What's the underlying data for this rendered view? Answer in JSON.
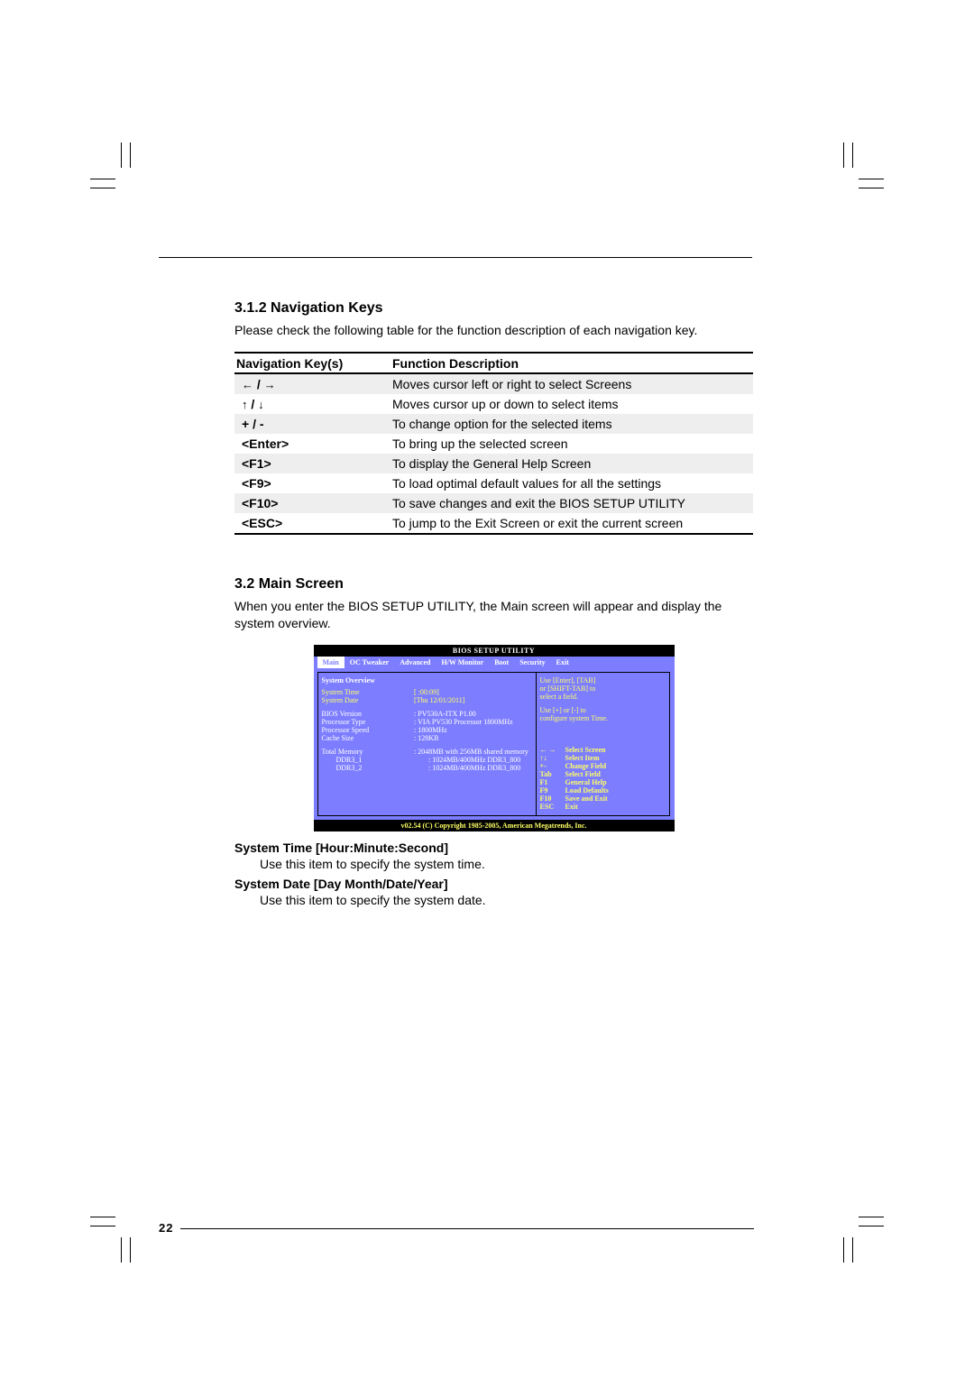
{
  "section1": {
    "title": "3.1.2 Navigation Keys",
    "intro": "Please check the following table for the function description of each navigation key."
  },
  "table": {
    "head_key": "Navigation Key(s)",
    "head_desc": "Function Description",
    "rows": [
      {
        "key": "← / →",
        "desc": "Moves cursor left or right to select Screens",
        "shaded": true,
        "arrows": "lr"
      },
      {
        "key": "↑ / ↓",
        "desc": "Moves cursor up or down to select items",
        "arrows": "ud"
      },
      {
        "key": "+  /  -",
        "desc": "To change option for the selected items",
        "shaded": true
      },
      {
        "key": "<Enter>",
        "desc": "To bring up the selected screen"
      },
      {
        "key": "<F1>",
        "desc": "To display the General Help Screen",
        "shaded": true
      },
      {
        "key": "<F9>",
        "desc": "To load optimal default values for all the settings"
      },
      {
        "key": "<F10>",
        "desc": "To save changes and exit the BIOS SETUP UTILITY",
        "shaded": true
      },
      {
        "key": "<ESC>",
        "desc": "To jump to the Exit Screen or exit the current screen",
        "end": true
      }
    ]
  },
  "section2": {
    "title": "3.2  Main Screen",
    "intro": "When you enter the BIOS SETUP UTILITY, the Main screen will appear and display the system overview."
  },
  "bios": {
    "title": "BIOS SETUP UTILITY",
    "tabs": [
      "Main",
      "OC Tweaker",
      "Advanced",
      "H/W Monitor",
      "Boot",
      "Security",
      "Exit"
    ],
    "overview": "System Overview",
    "sysTimeLabel": "System Time",
    "sysTimeValue": "[  :00:09]",
    "sysDateLabel": "System Date",
    "sysDateValue": "[Thu 12/01/2011]",
    "info": [
      {
        "lab": "BIOS Version",
        "val": ": PV530A-ITX P1.00"
      },
      {
        "lab": "Processor Type",
        "val": ": VIA PV530 Processor 1800MHz"
      },
      {
        "lab": "Processor Speed",
        "val": ": 1800MHz"
      },
      {
        "lab": "Cache Size",
        "val": ": 128KB"
      }
    ],
    "mem": [
      {
        "lab": "Total Memory",
        "val": ": 2048MB with 256MB shared memory"
      },
      {
        "lab": "DDR3_1",
        "val": ": 1024MB/400MHz DDR3_800"
      },
      {
        "lab": "DDR3_2",
        "val": ": 1024MB/400MHz DDR3_800"
      }
    ],
    "hint1": "Use [Enter], [TAB]",
    "hint2": "or [SHIFT-TAB] to",
    "hint3": "select a field.",
    "hint4": "Use [+] or [-] to",
    "hint5": "configure system Time.",
    "legend": [
      {
        "k": "← →",
        "v": "Select Screen"
      },
      {
        "k": "↑↓",
        "v": "Select Item"
      },
      {
        "k": "+-",
        "v": "Change Field"
      },
      {
        "k": "Tab",
        "v": "Select Field"
      },
      {
        "k": "F1",
        "v": "General Help"
      },
      {
        "k": "F9",
        "v": "Load Defaults"
      },
      {
        "k": "F10",
        "v": "Save and Exit"
      },
      {
        "k": "ESC",
        "v": "Exit"
      }
    ],
    "copy": "v02.54 (C) Copyright 1985-2005, American Megatrends, Inc."
  },
  "defs": [
    {
      "title": "System Time [Hour:Minute:Second]",
      "body": "Use this item to specify the system time."
    },
    {
      "title": "System Date [Day Month/Date/Year]",
      "body": "Use this item to specify the system date."
    }
  ],
  "pageNumber": "22"
}
